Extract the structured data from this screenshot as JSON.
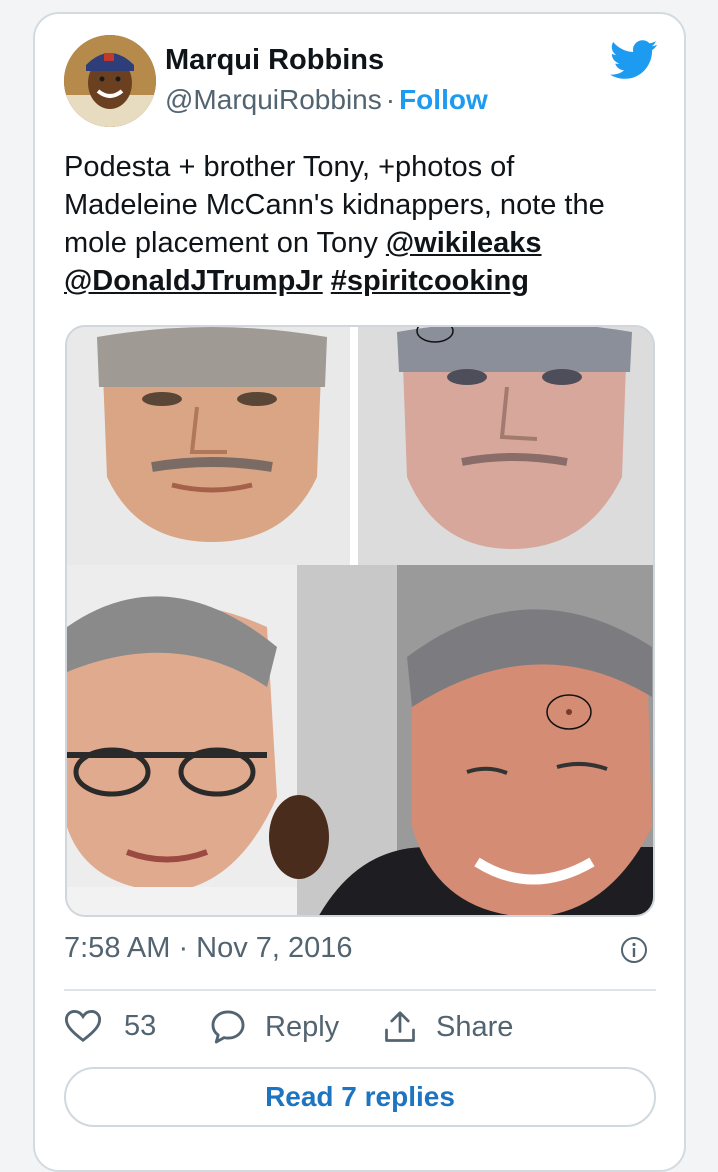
{
  "author": {
    "name": "Marqui Robbins",
    "handle": "@MarquiRobbins",
    "separator": "·",
    "follow_label": "Follow"
  },
  "tweet": {
    "text_plain": "Podesta + brother Tony, +photos of Madeleine McCann's kidnappers, note the mole placement on Tony ",
    "mention1": "@wikileaks",
    "mention2": "@DonaldJTrumpJr",
    "hashtag": "#spiritcooking",
    "timestamp": "7:58 AM · Nov 7, 2016"
  },
  "actions": {
    "likes_count": "53",
    "reply_label": "Reply",
    "share_label": "Share"
  },
  "read_replies_label": "Read 7 replies",
  "icons": {
    "brand": "twitter-bird-icon",
    "info": "info-icon",
    "like": "heart-icon",
    "reply": "reply-bubble-icon",
    "share": "share-icon"
  },
  "colors": {
    "accent": "#1d9bf0",
    "text": "#0f1419",
    "muted": "#536471"
  }
}
